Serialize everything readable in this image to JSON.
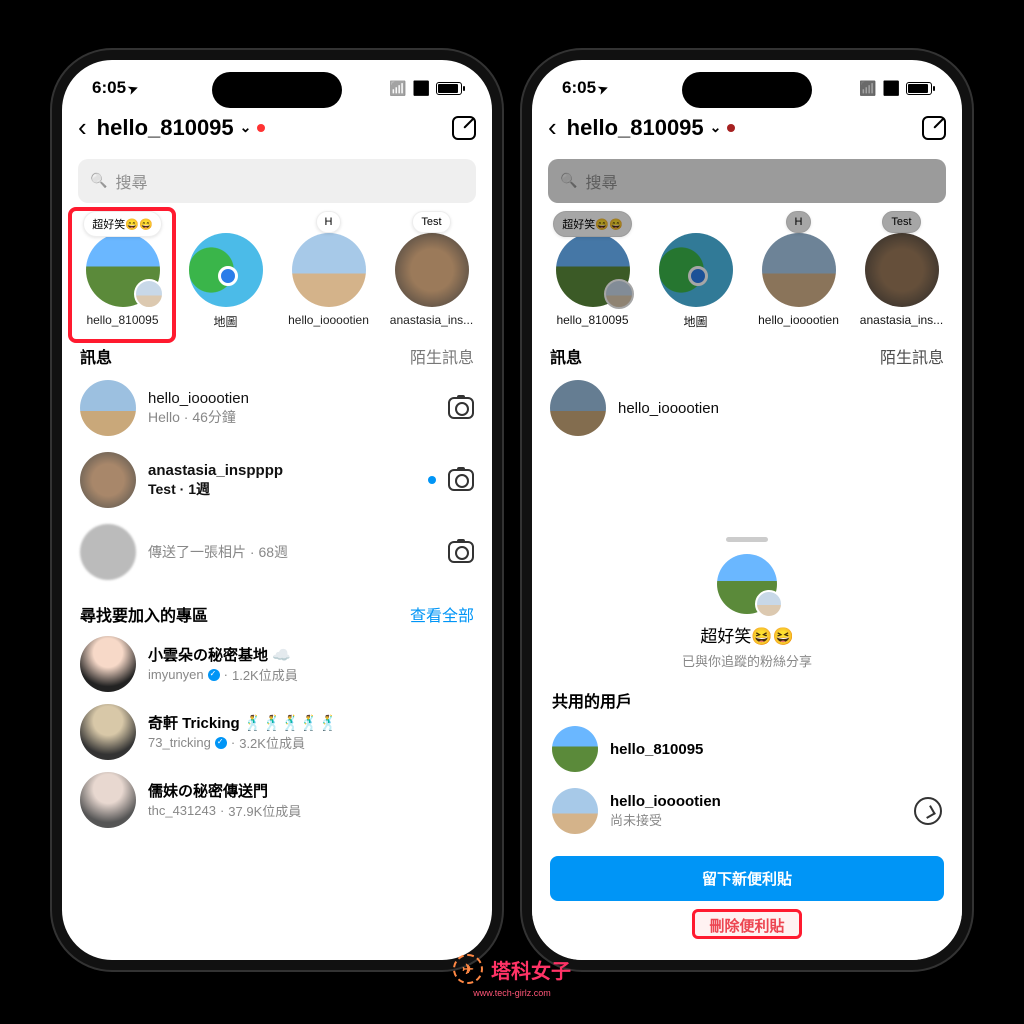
{
  "status": {
    "time": "6:05",
    "location_arrow": true
  },
  "header": {
    "title": "hello_810095",
    "has_unread_dot": true
  },
  "search": {
    "placeholder": "搜尋"
  },
  "notes": [
    {
      "bubble": "超好笑😄😄",
      "label": "hello_810095",
      "highlighted": true
    },
    {
      "bubble": "",
      "label": "地圖",
      "variant": "map"
    },
    {
      "bubble": "H",
      "label": "hello_iooootien",
      "variant": "plane"
    },
    {
      "bubble": "Test",
      "label": "anastasia_ins...",
      "variant": "cat"
    }
  ],
  "messages_section": {
    "title": "訊息",
    "right": "陌生訊息"
  },
  "messages": [
    {
      "name": "hello_iooootien",
      "sub": "Hello · 46分鐘",
      "bold": false,
      "variant": "plane"
    },
    {
      "name": "anastasia_inspppp",
      "sub": "Test · 1週",
      "bold": true,
      "unread": true,
      "variant": "cat"
    },
    {
      "name": "",
      "sub": "傳送了一張相片 · 68週",
      "bold": false,
      "variant": "blur"
    }
  ],
  "channels_section": {
    "title": "尋找要加入的專區",
    "right": "查看全部"
  },
  "channels": [
    {
      "name": "小雲朵の秘密基地 ☁️",
      "handle": "imyunyen",
      "members": "1.2K位成員",
      "av": "a1"
    },
    {
      "name": "奇軒 Tricking 🕺🕺🕺🕺🕺",
      "handle": "73_tricking",
      "members": "3.2K位成員",
      "av": "a2"
    },
    {
      "name": "儒妹の秘密傳送門",
      "handle": "thc_431243",
      "members": "37.9K位成員",
      "av": "a3"
    }
  ],
  "sheet": {
    "title": "超好笑😆😆",
    "subtitle": "已與你追蹤的粉絲分享",
    "section_label": "共用的用戶",
    "users": [
      {
        "name": "hello_810095",
        "sub": "",
        "av": "u1"
      },
      {
        "name": "hello_iooootien",
        "sub": "尚未接受",
        "av": "u2",
        "messenger": true
      }
    ],
    "primary_btn": "留下新便利貼",
    "danger_btn": "刪除便利貼"
  },
  "watermark": {
    "text": "塔科女子",
    "url": "www.tech-girlz.com"
  }
}
